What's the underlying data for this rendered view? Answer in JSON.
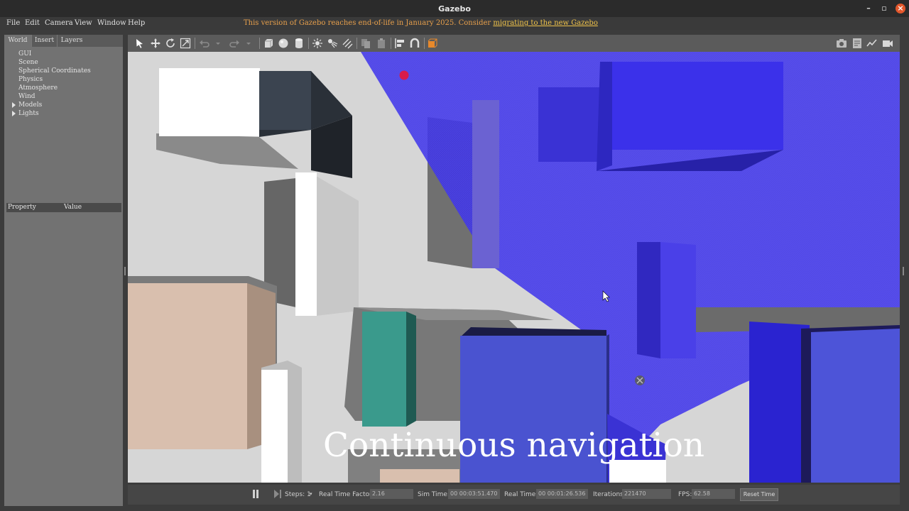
{
  "window": {
    "title": "Gazebo"
  },
  "menu": [
    "File",
    "Edit",
    "Camera",
    "View",
    "Window",
    "Help"
  ],
  "notice": {
    "text": "This version of Gazebo reaches end-of-life in January 2025. Consider",
    "link": "migrating to the new Gazebo"
  },
  "left_panel": {
    "tabs": [
      "World",
      "Insert",
      "Layers"
    ],
    "tree": [
      "GUI",
      "Scene",
      "Spherical Coordinates",
      "Physics",
      "Atmosphere",
      "Wind",
      "Models",
      "Lights"
    ],
    "property_header": {
      "property": "Property",
      "value": "Value"
    }
  },
  "toolbar": {
    "left_icons": [
      "select-icon",
      "translate-icon",
      "rotate-icon",
      "scale-icon",
      "undo-icon",
      "redo-icon",
      "box-icon",
      "sphere-icon",
      "cylinder-icon",
      "point-light-icon",
      "spot-light-icon",
      "directional-light-icon",
      "copy-icon",
      "paste-icon",
      "align-icon",
      "snap-icon",
      "view-angle-icon"
    ],
    "right_icons": [
      "screenshot-icon",
      "log-icon",
      "plot-icon",
      "record-video-icon"
    ]
  },
  "viewport": {
    "caption": "Continuous navigation"
  },
  "bottom_bar": {
    "steps_label": "Steps: 1",
    "rtf_label": "Real Time Factor:",
    "rtf_value": "2.16",
    "sim_time_label": "Sim Time:",
    "sim_time_value": "00 00:03:51.470",
    "real_time_label": "Real Time:",
    "real_time_value": "00 00:01:26.536",
    "iterations_label": "Iterations:",
    "iterations_value": "221470",
    "fps_label": "FPS:",
    "fps_value": "62.58",
    "reset_label": "Reset Time"
  },
  "colors": {
    "laser": "#3d33e8",
    "goal_marker": "#d81b4a",
    "title_bar": "#2b2b2b",
    "close_button": "#e2572c"
  }
}
